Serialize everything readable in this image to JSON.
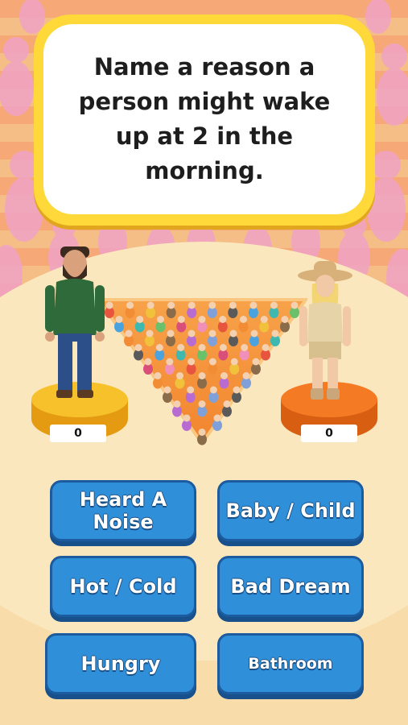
{
  "question": {
    "text": "Name a reason a person might wake up at 2 in the morning."
  },
  "scores": {
    "left": "0",
    "right": "0"
  },
  "players": {
    "left_icon": "bearded-man-player-icon",
    "right_icon": "safari-woman-player-icon"
  },
  "answers": [
    {
      "label": "Heard A Noise"
    },
    {
      "label": "Baby / Child"
    },
    {
      "label": "Hot / Cold"
    },
    {
      "label": "Bad Dream"
    },
    {
      "label": "Hungry"
    },
    {
      "label": "Bathroom"
    }
  ],
  "colors": {
    "card_border": "#ffd93a",
    "button": "#2f8fd8",
    "left_pedestal": "#f7c12b",
    "right_pedestal": "#f57a24"
  }
}
